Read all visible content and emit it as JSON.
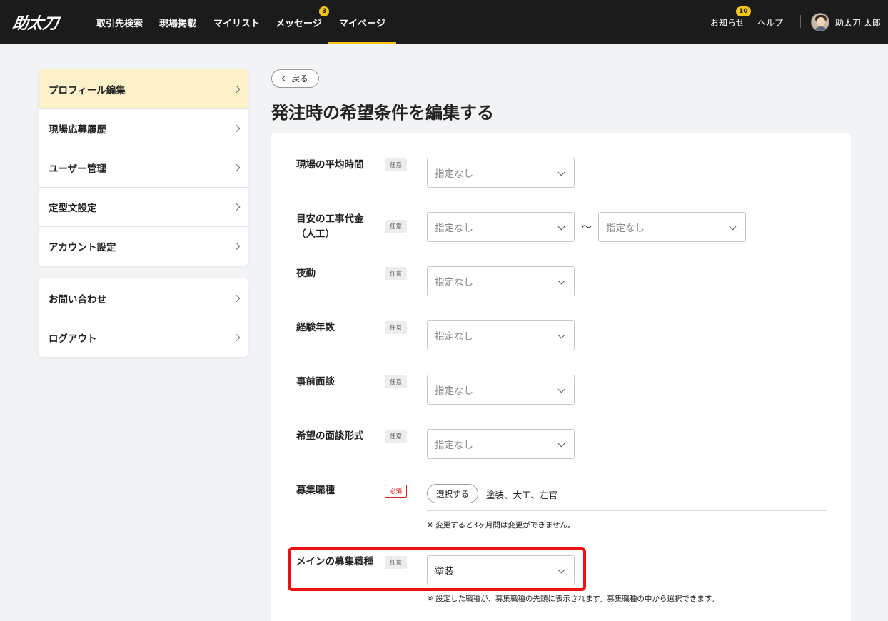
{
  "header": {
    "logo": "助太刀",
    "nav": [
      "取引先検索",
      "現場掲載",
      "マイリスト",
      "メッセージ",
      "マイページ"
    ],
    "message_badge": "3",
    "notice_label": "お知らせ",
    "notice_badge": "10",
    "help_label": "ヘルプ",
    "user_name": "助太刀 太郎"
  },
  "sidebar": {
    "group1": [
      "プロフィール編集",
      "現場応募履歴",
      "ユーザー管理",
      "定型文設定",
      "アカウント設定"
    ],
    "group2": [
      "お問い合わせ",
      "ログアウト"
    ]
  },
  "main": {
    "back_label": "戻る",
    "title": "発注時の希望条件を編集する",
    "placeholder": "指定なし",
    "optional_tag": "任意",
    "required_tag": "必須",
    "tilde": "〜",
    "fields": {
      "avg_time": "現場の平均時間",
      "cost_line1": "目安の工事代金",
      "cost_line2": "（人工）",
      "night": "夜勤",
      "experience": "経験年数",
      "interview": "事前面談",
      "interview_format": "希望の面談形式",
      "job_types": "募集職種",
      "main_job_type": "メインの募集職種"
    },
    "select_button": "選択する",
    "selected_job_types": "塗装、大工、左官",
    "job_types_note": "※ 変更すると3ヶ月間は変更ができません。",
    "main_job_value": "塗装",
    "main_job_note": "※ 設定した職種が、募集職種の先頭に表示されます。募集職種の中から選択できます。"
  },
  "colors": {
    "header_bg": "#1b1b1b",
    "accent": "#f5c518",
    "active_sidebar": "#fdf1c9",
    "highlight_frame": "#ee1111"
  }
}
